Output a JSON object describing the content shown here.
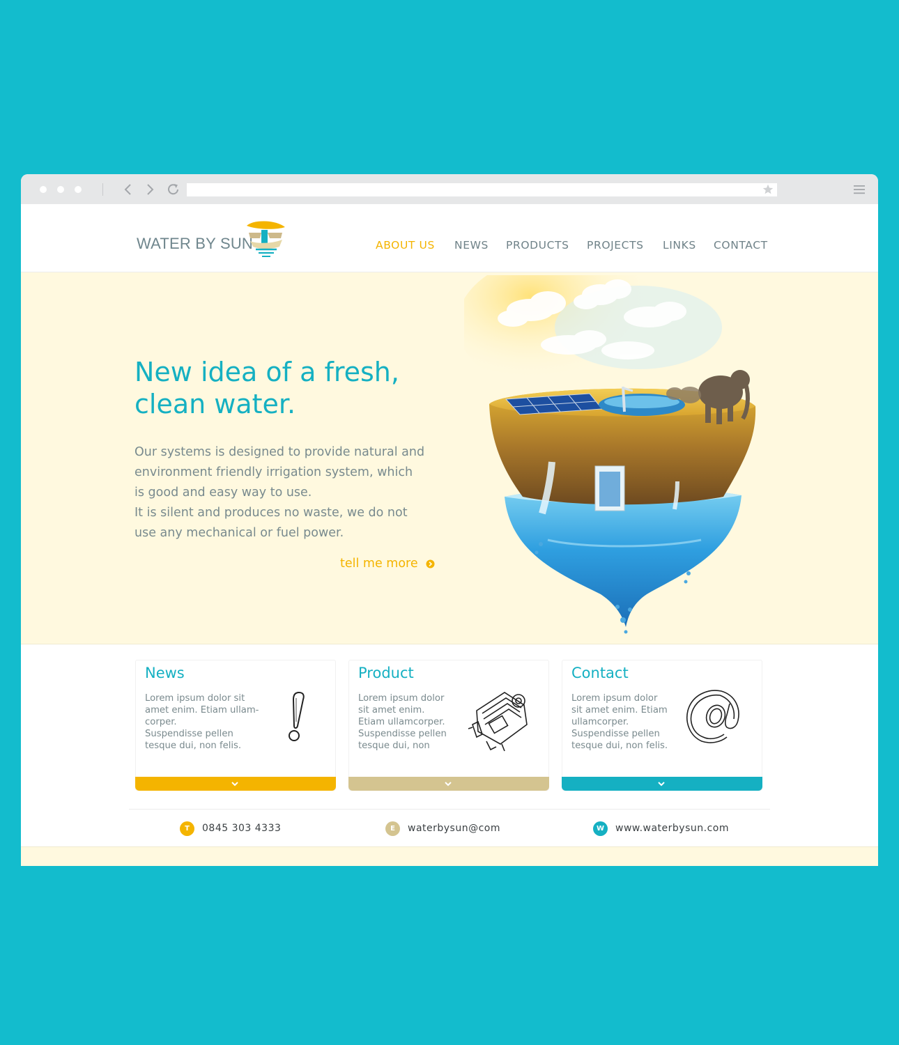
{
  "colors": {
    "page_bg": "#13bccd",
    "accent_yellow": "#f4b400",
    "accent_tan": "#d4c490",
    "accent_teal": "#15b0c2",
    "hero_bg": "#fff9df",
    "nav_text": "#6f8288"
  },
  "browser": {
    "window_dots": [
      "dot",
      "dot",
      "dot"
    ],
    "icons": [
      "back-icon",
      "forward-icon",
      "reload-icon",
      "star-icon",
      "menu-icon"
    ],
    "url": ""
  },
  "header": {
    "logo_text": "WATER BY SUN",
    "nav": [
      {
        "label": "ABOUT US",
        "active": true
      },
      {
        "label": "NEWS",
        "active": false
      },
      {
        "label": "PRODUCTS",
        "active": false
      },
      {
        "label": "PROJECTS",
        "active": false
      },
      {
        "label": "LINKS",
        "active": false
      },
      {
        "label": "CONTACT",
        "active": false
      }
    ]
  },
  "hero": {
    "title_line1": "New idea of a fresh,",
    "title_line2": "clean water.",
    "text_lines": [
      "Our systems is designed to provide natural and",
      "environment friendly irrigation system, which",
      "is good and easy way to use.",
      "It is silent and produces no waste, we do not",
      "use any mechanical or fuel power."
    ],
    "more_label": "tell me more"
  },
  "cards": [
    {
      "title": "News",
      "lines": [
        "Lorem ipsum dolor sit",
        "amet enim. Etiam ullam-",
        "corper.",
        "Suspendisse pellen",
        "tesque dui, non felis."
      ],
      "icon": "exclamation-icon",
      "bar_color": "#f4b400"
    },
    {
      "title": "Product",
      "lines": [
        "Lorem ipsum dolor",
        "sit amet enim.",
        "Etiam ullamcorper.",
        "Suspendisse pellen",
        "tesque dui, non"
      ],
      "icon": "engine-icon",
      "bar_color": "#d4c490"
    },
    {
      "title": "Contact",
      "lines": [
        "Lorem ipsum dolor",
        "sit amet enim. Etiam",
        "ullamcorper.",
        "Suspendisse pellen",
        "tesque dui, non felis."
      ],
      "icon": "at-icon",
      "bar_color": "#15b0c2"
    }
  ],
  "footer": {
    "phone": {
      "badge": "T",
      "value": "0845 303 4333",
      "color": "#f4b400"
    },
    "email": {
      "badge": "E",
      "value": "waterbysun@com",
      "color": "#d4c490"
    },
    "web": {
      "badge": "W",
      "value": "www.waterbysun.com",
      "color": "#15b0c2"
    }
  }
}
